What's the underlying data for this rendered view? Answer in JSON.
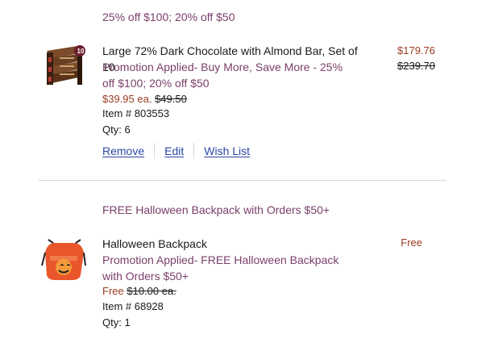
{
  "promo_header_1": "25% off $100; 20% off $50",
  "item1": {
    "title": "Large 72% Dark Chocolate with Almond Bar, Set of 10",
    "promo": "Promotion Applied- Buy More, Save More - 25% off $100; 20% off $50",
    "each_price": "$39.95 ea.",
    "orig_each_price": "$49.50",
    "item_number": "Item # 803553",
    "qty": "Qty: 6",
    "line_total": "$179.76",
    "orig_line_total": "$239.70",
    "badge": "10",
    "actions": {
      "remove": "Remove",
      "edit": "Edit",
      "wishlist": "Wish List"
    }
  },
  "promo_header_2": "FREE Halloween Backpack with Orders $50+",
  "item2": {
    "title": "Halloween Backpack",
    "promo": "Promotion Applied- FREE Halloween Backpack with Orders $50+",
    "each_price": "Free",
    "orig_each_price": "$10.00 ea.",
    "item_number": "Item # 68928",
    "qty": "Qty: 1",
    "line_total": "Free"
  },
  "colors": {
    "promo_purple": "#7a3f6a",
    "price_red": "#9a3b1f",
    "link_blue": "#2a46a8",
    "divider_gray": "#d8d8d8"
  },
  "icons": {
    "item1_thumb": "chocolate-box-stack-icon",
    "item2_thumb": "halloween-backpack-icon"
  }
}
